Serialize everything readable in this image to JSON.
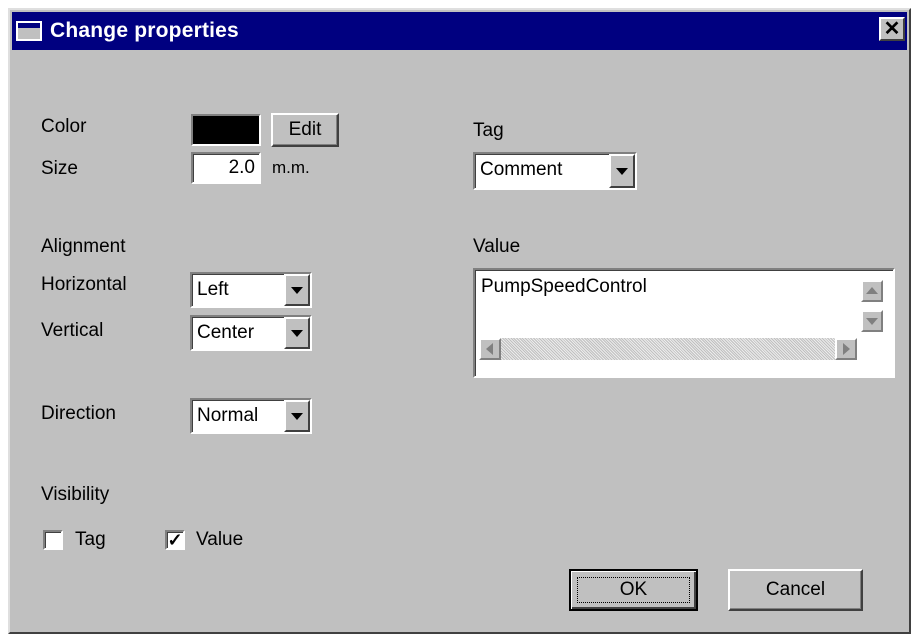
{
  "window": {
    "title": "Change properties"
  },
  "colors": {
    "titlebar": "#000080",
    "dialog": "#c0c0c0",
    "swatch": "#000000"
  },
  "labels": {
    "color": "Color",
    "size": "Size",
    "alignment": "Alignment",
    "horizontal": "Horizontal",
    "vertical": "Vertical",
    "direction": "Direction",
    "visibility": "Visibility",
    "tag": "Tag",
    "value": "Value",
    "size_unit": "m.m."
  },
  "buttons": {
    "edit": "Edit",
    "ok": "OK",
    "cancel": "Cancel"
  },
  "fields": {
    "size": "2.0",
    "tag": "Comment",
    "horizontal": "Left",
    "vertical": "Center",
    "direction": "Normal",
    "value_text": "PumpSpeedControl"
  },
  "checkboxes": {
    "tag": {
      "label": "Tag",
      "checked": false,
      "mark": ""
    },
    "value": {
      "label": "Value",
      "checked": true,
      "mark": "✓"
    }
  },
  "icons": {
    "close": "close-icon",
    "window": "window-icon"
  }
}
